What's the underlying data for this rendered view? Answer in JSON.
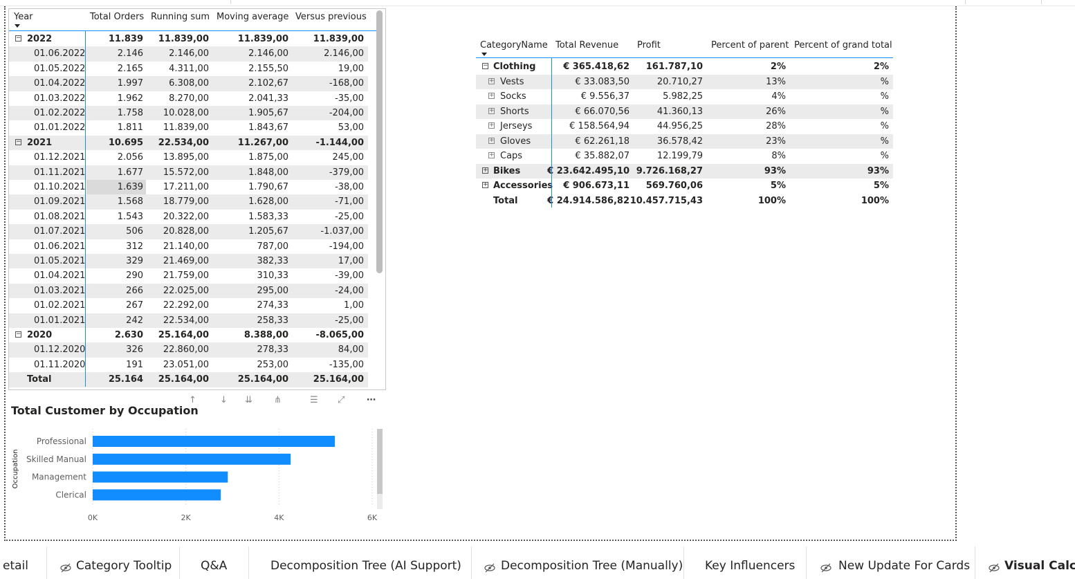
{
  "matrix1": {
    "headers": {
      "year": "Year",
      "total_orders": "Total Orders",
      "running_sum": "Running sum",
      "moving_average": "Moving average",
      "versus_previous": "Versus previous"
    },
    "rows": [
      {
        "label": "2022",
        "level": 0,
        "values": [
          "11.839",
          "11.839,00",
          "11.839,00",
          "11.839,00"
        ]
      },
      {
        "label": "01.06.2022",
        "level": 1,
        "values": [
          "2.146",
          "2.146,00",
          "2.146,00",
          "2.146,00"
        ]
      },
      {
        "label": "01.05.2022",
        "level": 1,
        "values": [
          "2.165",
          "4.311,00",
          "2.155,50",
          "19,00"
        ]
      },
      {
        "label": "01.04.2022",
        "level": 1,
        "values": [
          "1.997",
          "6.308,00",
          "2.102,67",
          "-168,00"
        ]
      },
      {
        "label": "01.03.2022",
        "level": 1,
        "values": [
          "1.962",
          "8.270,00",
          "2.041,33",
          "-35,00"
        ]
      },
      {
        "label": "01.02.2022",
        "level": 1,
        "values": [
          "1.758",
          "10.028,00",
          "1.905,67",
          "-204,00"
        ]
      },
      {
        "label": "01.01.2022",
        "level": 1,
        "values": [
          "1.811",
          "11.839,00",
          "1.843,67",
          "53,00"
        ]
      },
      {
        "label": "2021",
        "level": 0,
        "values": [
          "10.695",
          "22.534,00",
          "11.267,00",
          "-1.144,00"
        ]
      },
      {
        "label": "01.12.2021",
        "level": 1,
        "values": [
          "2.056",
          "13.895,00",
          "1.875,00",
          "245,00"
        ]
      },
      {
        "label": "01.11.2021",
        "level": 1,
        "values": [
          "1.677",
          "15.572,00",
          "1.848,00",
          "-379,00"
        ]
      },
      {
        "label": "01.10.2021",
        "level": 1,
        "values": [
          "1.639",
          "17.211,00",
          "1.790,67",
          "-38,00"
        ]
      },
      {
        "label": "01.09.2021",
        "level": 1,
        "values": [
          "1.568",
          "18.779,00",
          "1.628,00",
          "-71,00"
        ]
      },
      {
        "label": "01.08.2021",
        "level": 1,
        "values": [
          "1.543",
          "20.322,00",
          "1.583,33",
          "-25,00"
        ]
      },
      {
        "label": "01.07.2021",
        "level": 1,
        "values": [
          "506",
          "20.828,00",
          "1.205,67",
          "-1.037,00"
        ]
      },
      {
        "label": "01.06.2021",
        "level": 1,
        "values": [
          "312",
          "21.140,00",
          "787,00",
          "-194,00"
        ]
      },
      {
        "label": "01.05.2021",
        "level": 1,
        "values": [
          "329",
          "21.469,00",
          "382,33",
          "17,00"
        ]
      },
      {
        "label": "01.04.2021",
        "level": 1,
        "values": [
          "290",
          "21.759,00",
          "310,33",
          "-39,00"
        ]
      },
      {
        "label": "01.03.2021",
        "level": 1,
        "values": [
          "266",
          "22.025,00",
          "295,00",
          "-24,00"
        ]
      },
      {
        "label": "01.02.2021",
        "level": 1,
        "values": [
          "267",
          "22.292,00",
          "274,33",
          "1,00"
        ]
      },
      {
        "label": "01.01.2021",
        "level": 1,
        "values": [
          "242",
          "22.534,00",
          "258,33",
          "-25,00"
        ]
      },
      {
        "label": "2020",
        "level": 0,
        "values": [
          "2.630",
          "25.164,00",
          "8.388,00",
          "-8.065,00"
        ]
      },
      {
        "label": "01.12.2020",
        "level": 1,
        "values": [
          "326",
          "22.860,00",
          "278,33",
          "84,00"
        ]
      },
      {
        "label": "01.11.2020",
        "level": 1,
        "values": [
          "191",
          "23.051,00",
          "253,00",
          "-135,00"
        ]
      },
      {
        "label": "Total",
        "level": 2,
        "values": [
          "25.164",
          "25.164,00",
          "25.164,00",
          "25.164,00"
        ]
      }
    ]
  },
  "matrix2": {
    "headers": {
      "category": "CategoryName",
      "total_revenue": "Total Revenue",
      "profit": "Profit",
      "percent_parent": "Percent of parent",
      "percent_grand": "Percent of grand total"
    },
    "rows": [
      {
        "label": "Clothing",
        "level": 0,
        "expander": "⊟",
        "values": [
          "€ 365.418,62",
          "161.787,10",
          "2%",
          "2%"
        ]
      },
      {
        "label": "Vests",
        "level": 1,
        "expander": "⊞",
        "values": [
          "€ 33.083,50",
          "20.710,27",
          "13%",
          "%"
        ]
      },
      {
        "label": "Socks",
        "level": 1,
        "expander": "⊞",
        "values": [
          "€ 9.556,37",
          "5.982,25",
          "4%",
          "%"
        ]
      },
      {
        "label": "Shorts",
        "level": 1,
        "expander": "⊞",
        "values": [
          "€ 66.070,56",
          "41.360,13",
          "26%",
          "%"
        ]
      },
      {
        "label": "Jerseys",
        "level": 1,
        "expander": "⊞",
        "values": [
          "€ 158.564,94",
          "44.956,25",
          "28%",
          "%"
        ]
      },
      {
        "label": "Gloves",
        "level": 1,
        "expander": "⊞",
        "values": [
          "€ 62.261,18",
          "36.578,42",
          "23%",
          "%"
        ]
      },
      {
        "label": "Caps",
        "level": 1,
        "expander": "⊞",
        "values": [
          "€ 35.882,07",
          "12.199,79",
          "8%",
          "%"
        ]
      },
      {
        "label": "Bikes",
        "level": 0,
        "expander": "⊞",
        "values": [
          "€ 23.642.495,10",
          "9.726.168,27",
          "93%",
          "93%"
        ]
      },
      {
        "label": "Accessories",
        "level": 0,
        "expander": "⊞",
        "values": [
          "€ 906.673,11",
          "569.760,06",
          "5%",
          "5%"
        ]
      },
      {
        "label": "Total",
        "level": 2,
        "expander": "",
        "values": [
          "€ 24.914.586,82",
          "10.457.715,43",
          "100%",
          "100%"
        ]
      }
    ]
  },
  "visual_header_icons": [
    "up-arrow-icon",
    "down-arrow-icon",
    "expand-down-icon",
    "expand-all-icon",
    "filter-icon",
    "focus-mode-icon",
    "more-options-icon"
  ],
  "chart_data": {
    "type": "bar",
    "orientation": "horizontal",
    "title": "Total Customer by Occupation",
    "ylabel": "Occupation",
    "xlabel": "",
    "categories": [
      "Professional",
      "Skilled Manual",
      "Management",
      "Clerical"
    ],
    "values": [
      5200,
      4250,
      2900,
      2750
    ],
    "xlim": [
      0,
      6000
    ],
    "xticks": [
      "0K",
      "2K",
      "4K",
      "6K"
    ],
    "bar_color": "#118dff",
    "grid": "vertical dotted"
  },
  "tabs": [
    {
      "label": "etail",
      "hidden": false,
      "active": false
    },
    {
      "label": "Category Tooltip",
      "hidden": true,
      "active": false
    },
    {
      "label": "Q&A",
      "hidden": false,
      "active": false
    },
    {
      "label": "Decomposition Tree (AI Support)",
      "hidden": false,
      "active": false
    },
    {
      "label": "Decomposition Tree (Manually)",
      "hidden": true,
      "active": false
    },
    {
      "label": "Key Influencers",
      "hidden": false,
      "active": false
    },
    {
      "label": "New Update For Cards",
      "hidden": true,
      "active": false
    },
    {
      "label": "Visual Calcs",
      "hidden": true,
      "active": true
    }
  ]
}
